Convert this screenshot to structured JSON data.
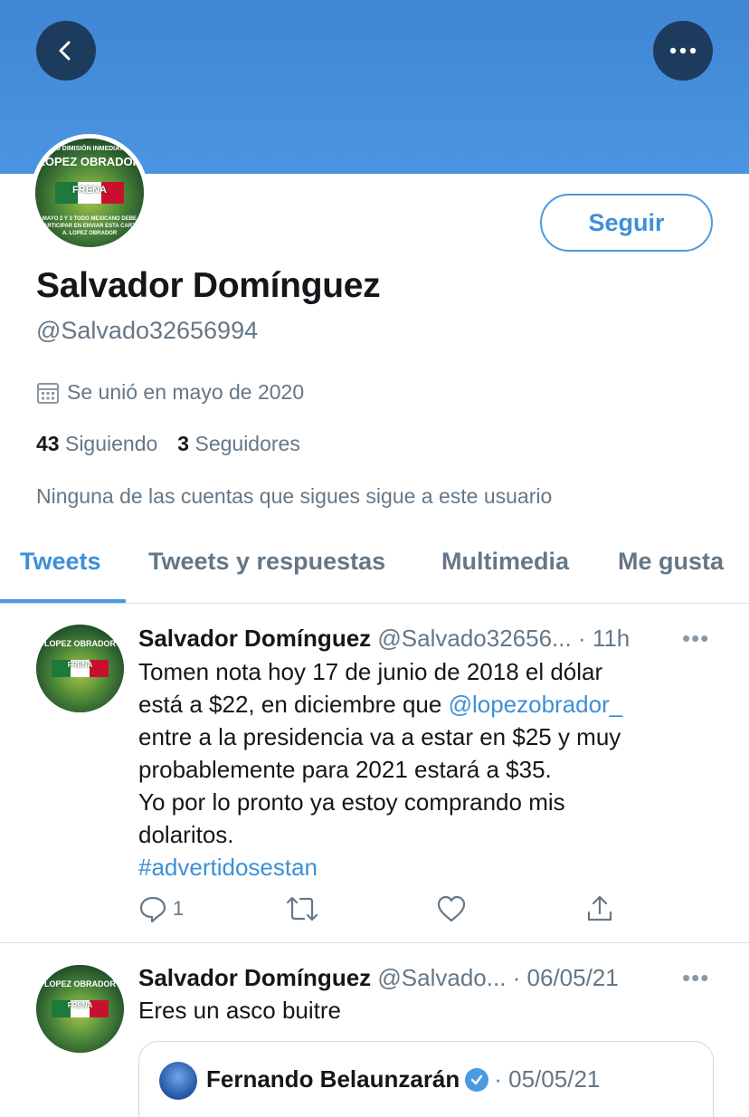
{
  "header": {
    "back_icon": "chevron-left-icon",
    "more_icon": "more-horizontal-icon",
    "banner_color": "#4a95e2"
  },
  "profile": {
    "avatar_lines": [
      "TU DIMISIÓN INMEDIATA",
      "LOPEZ OBRADOR",
      "FRENA",
      "MAYO 2 Y 3 TODO MEXICANO DEBE",
      "PARTICIPAR EN ENVIAR ESTA CARTA",
      "A. LOPEZ OBRADOR"
    ],
    "follow_label": "Seguir",
    "name": "Salvador Domínguez",
    "handle": "@Salvado32656994",
    "joined": "Se unió en mayo de 2020",
    "following_count": "43",
    "following_label": "Siguiendo",
    "followers_count": "3",
    "followers_label": "Seguidores",
    "mutuals_text": "Ninguna de las cuentas que sigues sigue a este usuario"
  },
  "tabs": [
    {
      "label": "Tweets",
      "active": true
    },
    {
      "label": "Tweets y respuestas",
      "active": false
    },
    {
      "label": "Multimedia",
      "active": false
    },
    {
      "label": "Me gusta",
      "active": false
    }
  ],
  "tweets": [
    {
      "name": "Salvador Domínguez",
      "handle_time": "@Salvado32656... · 11h",
      "more": "•••",
      "line1": "Tomen nota hoy 17 de junio de 2018  el dólar",
      "line2_pre": "está a $22, en diciembre que ",
      "mention": "@lopezobrador_",
      "line3": "entre a la presidencia va a estar en $25 y muy",
      "line4": "probablemente para 2021 estará a $35.",
      "line5": "Yo por lo pronto ya estoy comprando mis",
      "line6": "dolaritos.",
      "hashtag": "#advertidosestan",
      "reply_count": "1"
    },
    {
      "name": "Salvador Domínguez",
      "handle_time": "@Salvado... · 06/05/21",
      "more": "•••",
      "text": "Eres un asco buitre",
      "quote": {
        "name": "Fernando Belaunzarán",
        "date": "· 05/05/21"
      }
    }
  ],
  "colors": {
    "accent": "#3d8fd8",
    "muted": "#657786"
  }
}
